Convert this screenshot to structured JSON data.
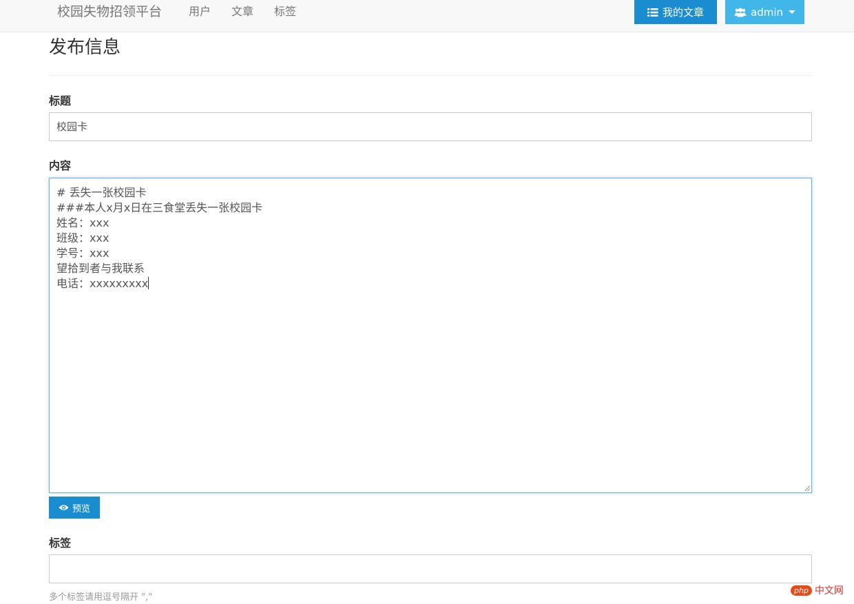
{
  "navbar": {
    "brand": "校园失物招领平台",
    "links": [
      "用户",
      "文章",
      "标签"
    ],
    "my_posts_label": "我的文章",
    "my_posts_icon": "list-icon",
    "admin_label": "admin",
    "admin_icon": "users-icon"
  },
  "page": {
    "title": "发布信息"
  },
  "form": {
    "title_label": "标题",
    "title_value": "校园卡",
    "content_label": "内容",
    "content_value": "# 丢失一张校园卡\n###本人x月x日在三食堂丢失一张校园卡\n姓名：xxx\n班级：xxx\n学号：xxx\n望拾到者与我联系\n电话：xxxxxxxxx",
    "preview_label": "预览",
    "preview_icon": "eye-icon",
    "tags_label": "标签",
    "tags_value": "",
    "tags_help": "多个标签请用逗号隔开 \",\""
  },
  "watermark": {
    "logo": "php",
    "text": "中文网"
  },
  "colors": {
    "primary": "#1a8dd1",
    "info": "#40b7e8",
    "focus_border": "#66afe9"
  }
}
